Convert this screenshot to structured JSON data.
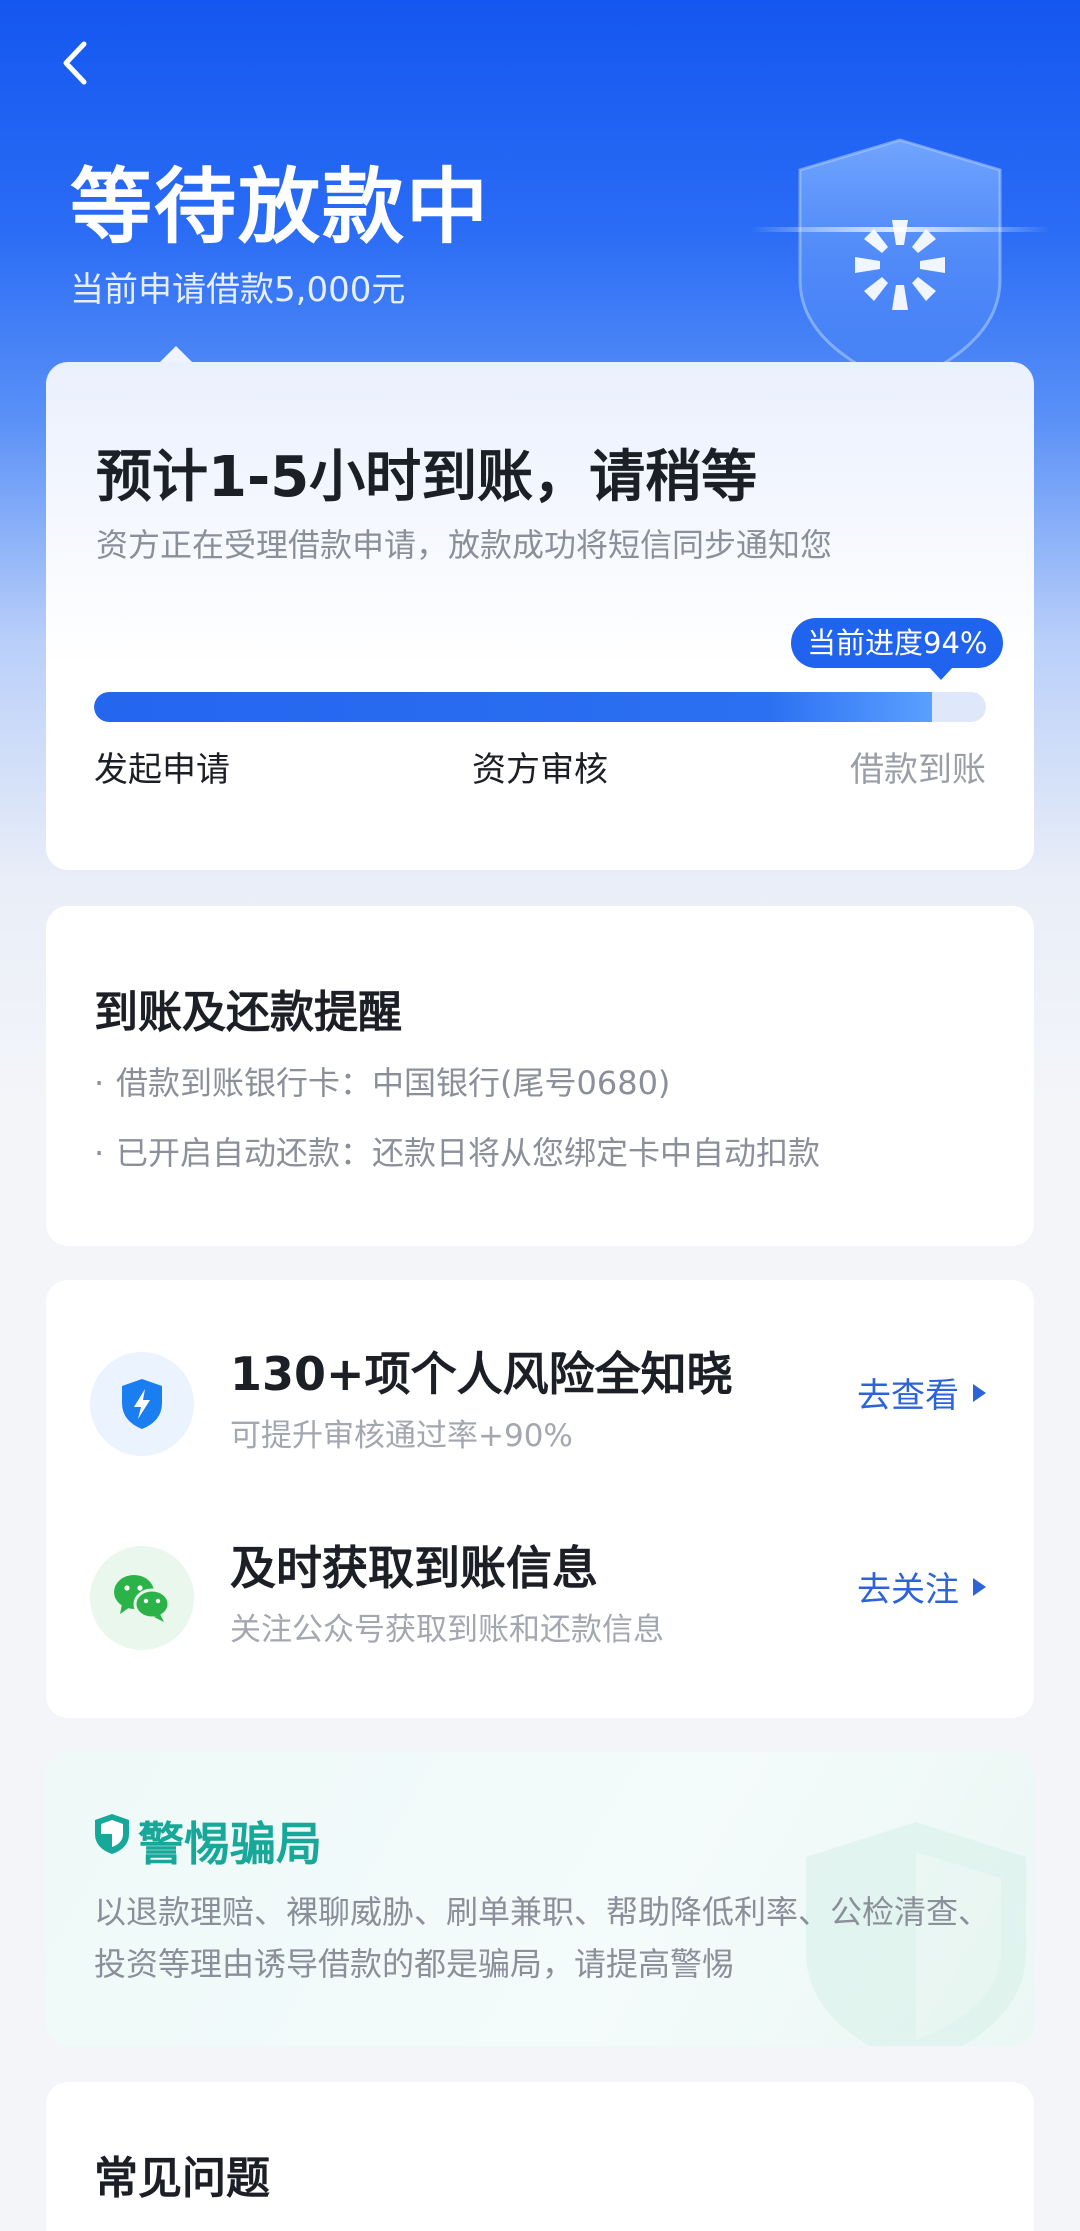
{
  "header": {
    "title": "等待放款中",
    "subtitle": "当前申请借款5,000元"
  },
  "status_card": {
    "title": "预计1-5小时到账，请稍等",
    "description": "资方正在受理借款申请，放款成功将短信同步通知您",
    "progress_label": "当前进度94%",
    "progress_percent": 94,
    "steps": [
      "发起申请",
      "资方审核",
      "借款到账"
    ]
  },
  "reminder": {
    "title": "到账及还款提醒",
    "bullet_mark": "·",
    "items": [
      "借款到账银行卡：中国银行(尾号0680)",
      "已开启自动还款：还款日将从您绑定卡中自动扣款"
    ]
  },
  "actions": [
    {
      "title": "130+项个人风险全知晓",
      "subtitle": "可提升审核通过率+90%",
      "link": "去查看",
      "icon": "lightning-shield-icon"
    },
    {
      "title": "及时获取到账信息",
      "subtitle": "关注公众号获取到账和还款信息",
      "link": "去关注",
      "icon": "wechat-icon"
    }
  ],
  "fraud": {
    "title": "警惕骗局",
    "text": "以退款理赔、裸聊威胁、刷单兼职、帮助降低利率、公检清查、投资等理由诱导借款的都是骗局，请提高警惕"
  },
  "faq": {
    "title": "常见问题"
  },
  "colors": {
    "primary": "#1f63ef",
    "fraud_accent": "#18a89a",
    "link": "#2d63d8"
  }
}
